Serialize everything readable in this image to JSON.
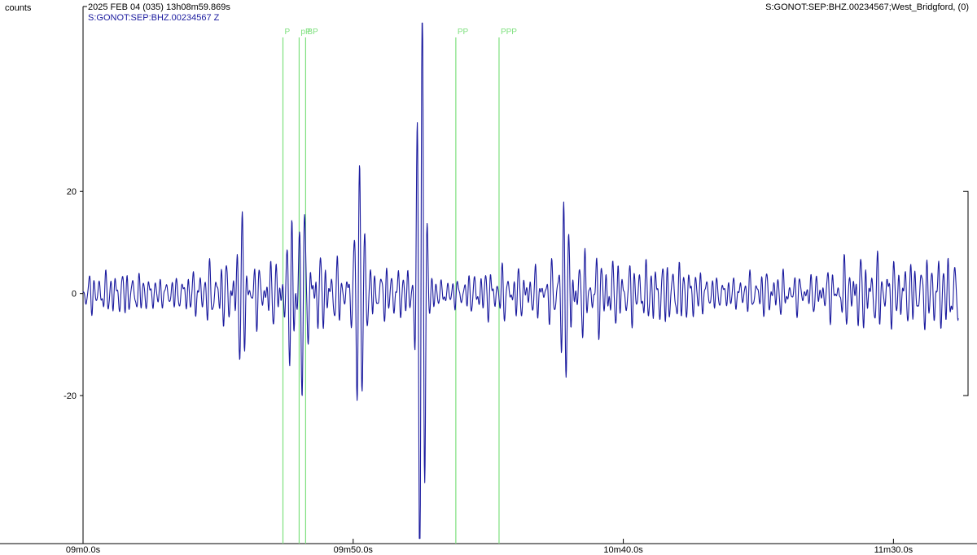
{
  "header": {
    "ylabel": "counts",
    "datetime": "2025 FEB 04 (035)  13h08m59.869s",
    "station_right": "S:GONOT:SEP:BHZ.00234567;West_Bridgford, (0)",
    "channel": "S:GONOT:SEP:BHZ.00234567 Z"
  },
  "chart_data": {
    "type": "line",
    "xlabel": "",
    "ylabel": "counts",
    "xlim": [
      540,
      702
    ],
    "ylim": [
      -49,
      54
    ],
    "x_ticks": [
      {
        "value": 540,
        "label": "09m0.0s"
      },
      {
        "value": 590,
        "label": "09m50.0s"
      },
      {
        "value": 640,
        "label": "10m40.0s"
      },
      {
        "value": 690,
        "label": "11m30.0s"
      }
    ],
    "y_ticks": [
      {
        "value": 20,
        "label": "20"
      },
      {
        "value": 0,
        "label": "0"
      },
      {
        "value": -20,
        "label": "-20"
      }
    ],
    "phase_markers": [
      {
        "label": "P",
        "x": 577.0
      },
      {
        "label": "pP",
        "x": 580.0
      },
      {
        "label": "BP",
        "x": 581.2
      },
      {
        "label": "PP",
        "x": 609.0
      },
      {
        "label": "PPP",
        "x": 617.0
      }
    ],
    "series": [
      {
        "color": "#1a1a9e",
        "wave": {
          "background_amplitude": 7,
          "peaks": [
            {
              "time": 581.3,
              "value": 20
            },
            {
              "time": 580.5,
              "value": -23
            },
            {
              "time": 591.2,
              "value": 30
            },
            {
              "time": 602.8,
              "value": 42
            },
            {
              "time": 602.3,
              "value": -35
            },
            {
              "time": 569.4,
              "value": 17
            },
            {
              "time": 578.6,
              "value": 15
            },
            {
              "time": 629.0,
              "value": 18
            }
          ]
        }
      }
    ]
  }
}
